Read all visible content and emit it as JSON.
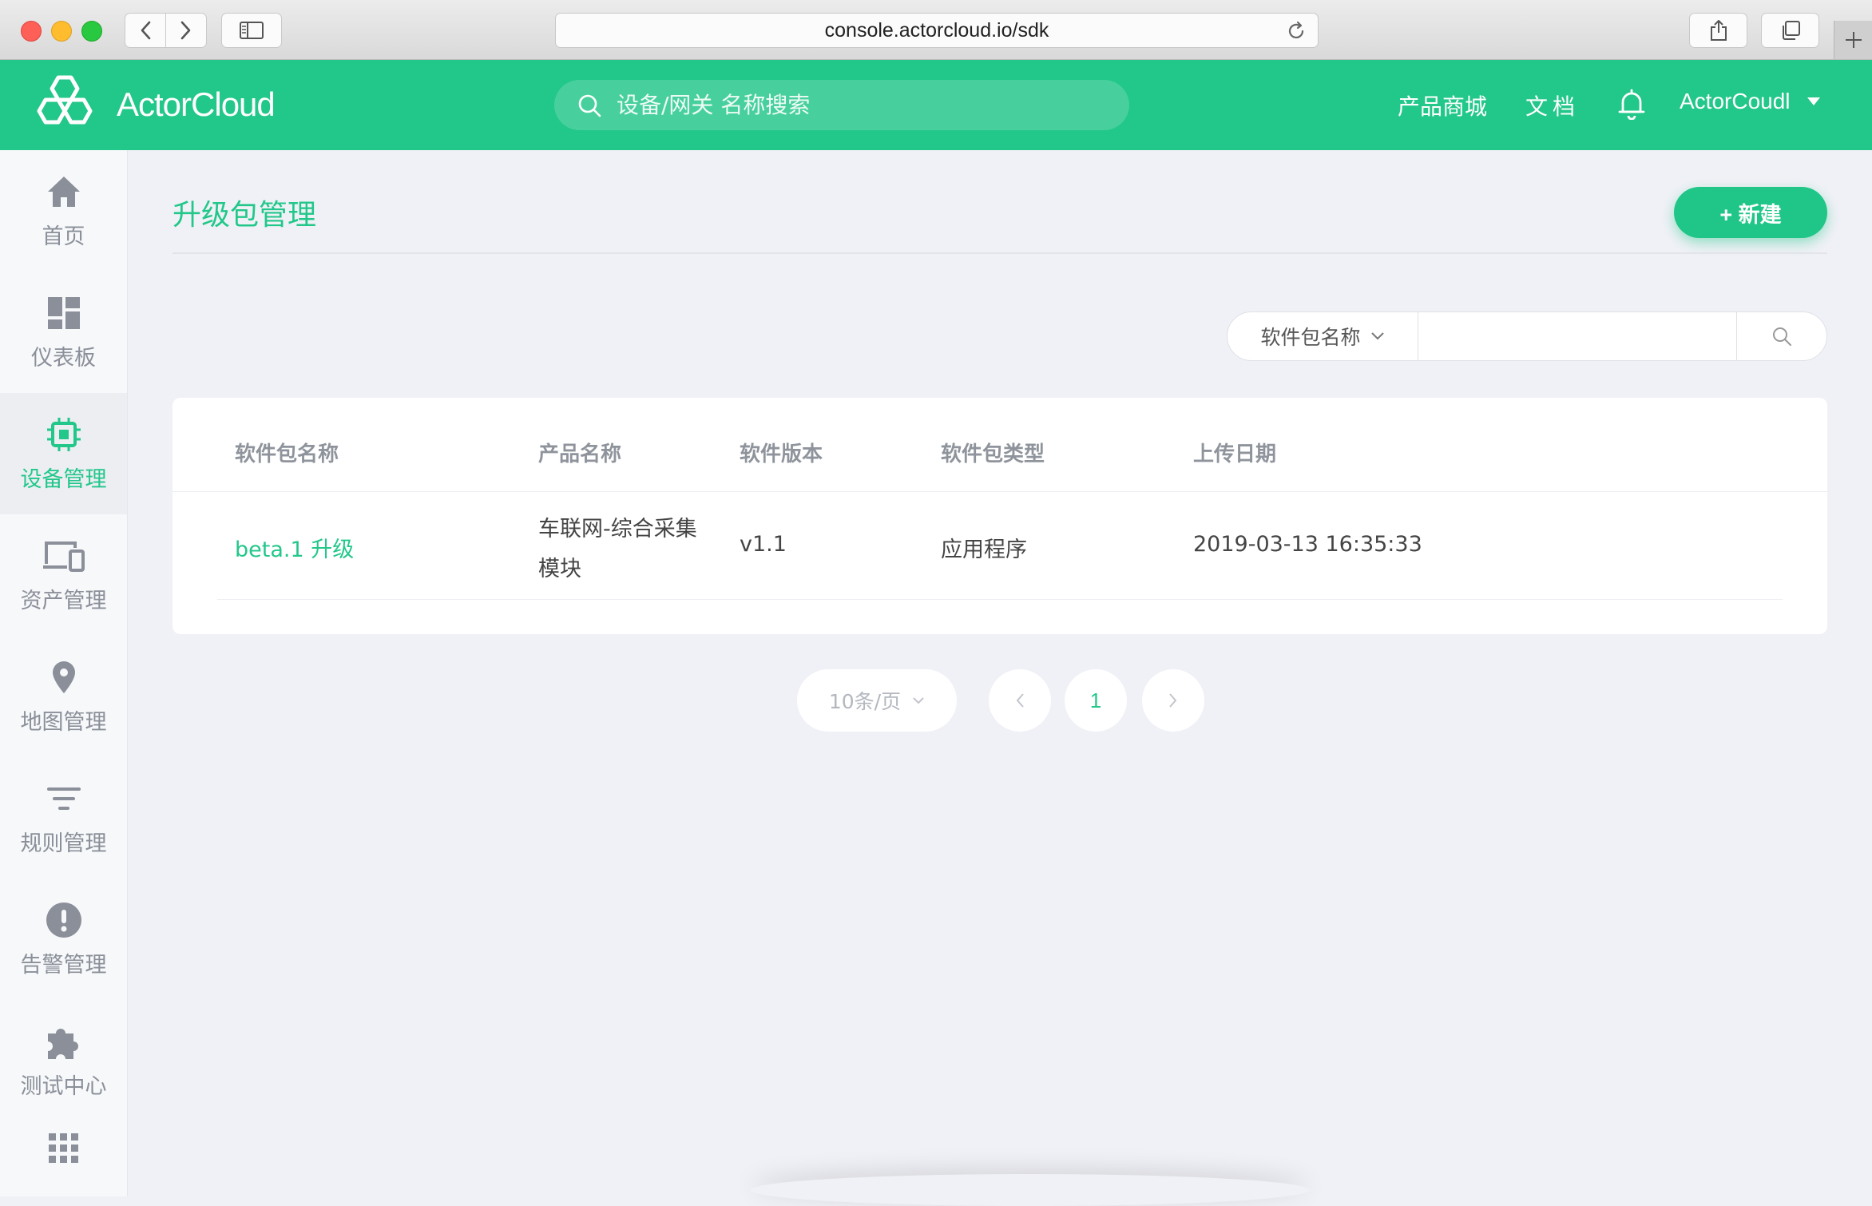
{
  "browser": {
    "url": "console.actorcloud.io/sdk"
  },
  "header": {
    "logo_text": "ActorCloud",
    "search_placeholder": "设备/网关 名称搜索",
    "links": {
      "store": "产品商城",
      "docs": "文档"
    },
    "user_name": "ActorCoudl"
  },
  "sidebar": {
    "items": [
      {
        "label": "首页",
        "icon": "home-icon",
        "active": false
      },
      {
        "label": "仪表板",
        "icon": "dashboard-icon",
        "active": false
      },
      {
        "label": "设备管理",
        "icon": "chip-icon",
        "active": true
      },
      {
        "label": "资产管理",
        "icon": "devices-icon",
        "active": false
      },
      {
        "label": "地图管理",
        "icon": "map-pin-icon",
        "active": false
      },
      {
        "label": "规则管理",
        "icon": "filter-icon",
        "active": false
      },
      {
        "label": "告警管理",
        "icon": "alert-icon",
        "active": false
      },
      {
        "label": "测试中心",
        "icon": "puzzle-icon",
        "active": false
      },
      {
        "label": "",
        "icon": "apps-grid-icon",
        "active": false
      }
    ]
  },
  "main": {
    "title": "升级包管理",
    "create_label": "+ 新建",
    "filter": {
      "selected_field": "软件包名称",
      "value": ""
    },
    "table": {
      "columns": [
        "软件包名称",
        "产品名称",
        "软件版本",
        "软件包类型",
        "上传日期"
      ],
      "rows": [
        {
          "name": "beta.1 升级",
          "product": "车联网-综合采集模块",
          "version": "v1.1",
          "type": "应用程序",
          "uploaded": "2019-03-13 16:35:33"
        }
      ]
    },
    "pagination": {
      "page_size": "10条/页",
      "current_page": "1"
    }
  },
  "colors": {
    "brand": "#22c78a",
    "nav_inactive": "#8a8f99",
    "background": "#f0f1f6"
  }
}
